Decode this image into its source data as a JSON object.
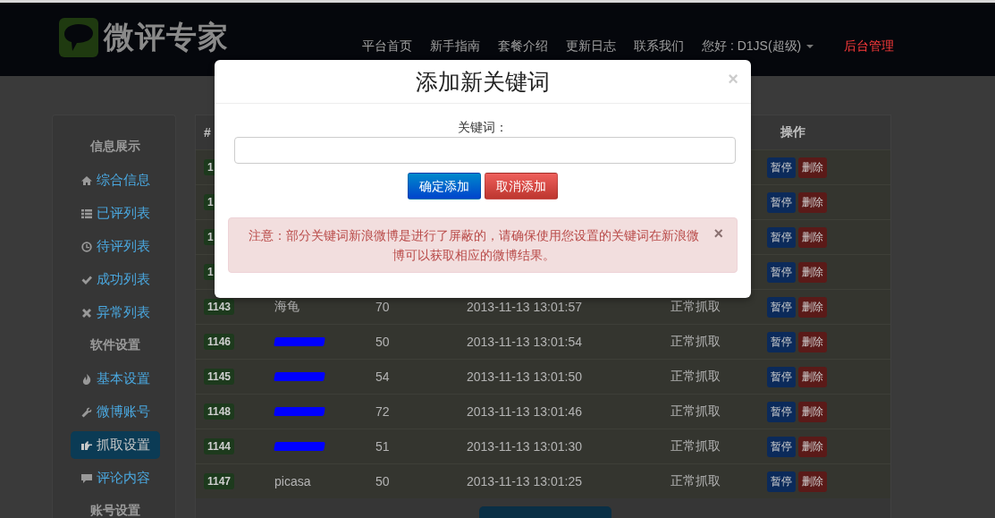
{
  "navbar": {
    "logo": "微评专家",
    "links": [
      {
        "label": "平台首页",
        "kind": "link"
      },
      {
        "label": "新手指南",
        "kind": "link"
      },
      {
        "label": "套餐介绍",
        "kind": "link"
      },
      {
        "label": "更新日志",
        "kind": "link"
      },
      {
        "label": "联系我们",
        "kind": "link"
      },
      {
        "label": "您好 : D1JS(超级)",
        "kind": "dropdown"
      },
      {
        "label": "后台管理",
        "kind": "admin"
      }
    ]
  },
  "sidebar": {
    "sections": [
      {
        "heading": "信息展示",
        "items": [
          {
            "label": "综合信息",
            "kind": "home",
            "selected": false
          },
          {
            "label": "已评列表",
            "kind": "list",
            "selected": false
          },
          {
            "label": "待评列表",
            "kind": "clock",
            "selected": false
          },
          {
            "label": "成功列表",
            "kind": "check",
            "selected": false
          },
          {
            "label": "异常列表",
            "kind": "cross",
            "selected": false
          }
        ]
      },
      {
        "heading": "软件设置",
        "items": [
          {
            "label": "基本设置",
            "kind": "fire",
            "selected": false
          },
          {
            "label": "微博账号",
            "kind": "wrench",
            "selected": false
          },
          {
            "label": "抓取设置",
            "kind": "hand",
            "selected": true
          },
          {
            "label": "评论内容",
            "kind": "comment",
            "selected": false
          }
        ]
      },
      {
        "heading": "账号设置"
      }
    ]
  },
  "table": {
    "columns": [
      "#",
      "操作"
    ],
    "rows": [
      {
        "kind": "covered",
        "id": "1",
        "actions": [
          "暂停",
          "删除"
        ]
      },
      {
        "kind": "covered",
        "id": "1",
        "actions": [
          "暂停",
          "删除"
        ]
      },
      {
        "kind": "covered",
        "id": "1",
        "actions": [
          "暂停",
          "删除"
        ]
      },
      {
        "kind": "covered",
        "id": "1",
        "actions": [
          "暂停",
          "删除"
        ]
      },
      {
        "kind": "full",
        "id": "1143",
        "keyword": "海龟",
        "redacted": false,
        "count": "70",
        "time": "2013-11-13 13:01:57",
        "status": "正常抓取",
        "actions": [
          "暂停",
          "删除"
        ]
      },
      {
        "kind": "full",
        "id": "1146",
        "redacted": true,
        "count": "50",
        "time": "2013-11-13 13:01:54",
        "status": "正常抓取",
        "actions": [
          "暂停",
          "删除"
        ]
      },
      {
        "kind": "full",
        "id": "1145",
        "redacted": true,
        "count": "54",
        "time": "2013-11-13 13:01:50",
        "status": "正常抓取",
        "actions": [
          "暂停",
          "删除"
        ]
      },
      {
        "kind": "full",
        "id": "1148",
        "redacted": true,
        "count": "72",
        "time": "2013-11-13 13:01:46",
        "status": "正常抓取",
        "actions": [
          "暂停",
          "删除"
        ]
      },
      {
        "kind": "full",
        "id": "1144",
        "redacted": true,
        "count": "51",
        "time": "2013-11-13 13:01:30",
        "status": "正常抓取",
        "actions": [
          "暂停",
          "删除"
        ]
      },
      {
        "kind": "full",
        "id": "1147",
        "keyword": "picasa",
        "redacted": false,
        "count": "50",
        "time": "2013-11-13 13:01:25",
        "status": "正常抓取",
        "actions": [
          "暂停",
          "删除"
        ]
      }
    ]
  },
  "modal": {
    "title": "添加新关键词",
    "close": "×",
    "field_label": "关键词：",
    "buttons": [
      {
        "label": "确定添加",
        "kind": "primary"
      },
      {
        "label": "取消添加",
        "kind": "danger"
      }
    ],
    "alert": {
      "text": "注意：部分关键词新浪微博是进行了屏蔽的，请确保使用您设置的关键词在新浪微博可以获取相应的微博结果。",
      "close": "×"
    }
  }
}
